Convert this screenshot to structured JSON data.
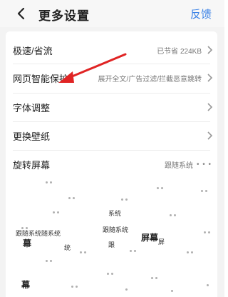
{
  "header": {
    "title": "更多设置",
    "feedback": "反馈"
  },
  "rows": [
    {
      "label": "极速/省流",
      "value": "已节省 224KB",
      "control": "chevron-right-icon"
    },
    {
      "label": "网页智能保护",
      "value": "展开全文/广告过滤/拦截恶意跳转",
      "control": "chevron-right-icon"
    },
    {
      "label": "字体调整",
      "value": "",
      "control": "chevron-right-icon"
    },
    {
      "label": "更换壁纸",
      "value": "",
      "control": "chevron-right-icon"
    },
    {
      "label": "旋转屏幕",
      "value": "跟随系统",
      "control": "more-dots-icon"
    }
  ],
  "fragments": [
    "系统",
    "跟随系统",
    "跟随系统随系统",
    "幕",
    "统",
    "跟",
    "屏幕",
    "屏",
    "幕"
  ],
  "annotation_arrow": {
    "color": "#e02424"
  }
}
